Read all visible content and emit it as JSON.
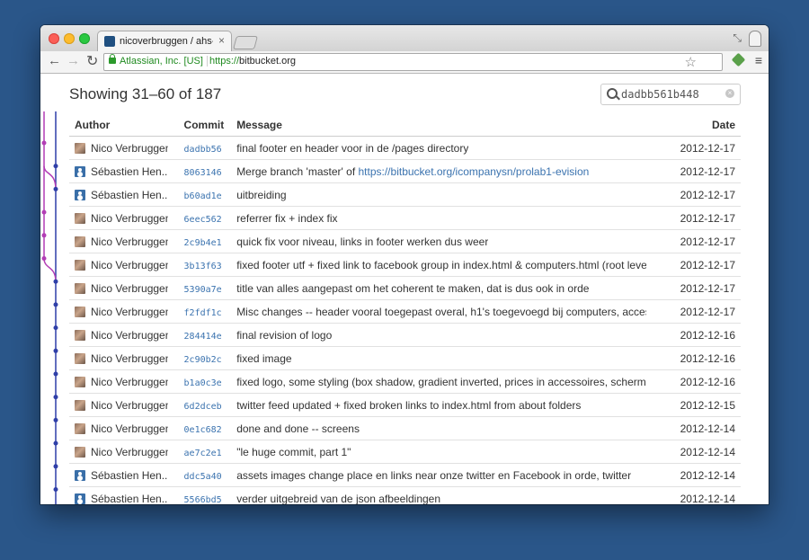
{
  "browser": {
    "tab_title": "nicoverbruggen / ahs-evi",
    "tab_close": "×",
    "ev_badge": "Atlassian, Inc. [US]",
    "url_scheme": "https://",
    "url_host": "bitbucket.org"
  },
  "page": {
    "heading": "Showing 31–60 of 187",
    "search": {
      "value": "dadbb561b448"
    },
    "columns": {
      "author": "Author",
      "commit": "Commit",
      "message": "Message",
      "date": "Date"
    }
  },
  "commits": [
    {
      "author": "Nico Verbruggen",
      "avatar": "photo",
      "hash": "dadbb56",
      "message": "final footer en header voor in de /pages directory",
      "date": "2012-12-17"
    },
    {
      "author": "Sébastien Hen...",
      "avatar": "default",
      "hash": "8063146",
      "message": "Merge branch 'master' of ",
      "link": "https://bitbucket.org/icompanysn/prolab1-evision",
      "date": "2012-12-17"
    },
    {
      "author": "Sébastien Hen...",
      "avatar": "default",
      "hash": "b60ad1e",
      "message": "uitbreiding",
      "date": "2012-12-17"
    },
    {
      "author": "Nico Verbruggen",
      "avatar": "photo",
      "hash": "6eec562",
      "message": "referrer fix + index fix",
      "date": "2012-12-17"
    },
    {
      "author": "Nico Verbruggen",
      "avatar": "photo",
      "hash": "2c9b4e1",
      "message": "quick fix voor niveau, links in footer werken dus weer",
      "date": "2012-12-17"
    },
    {
      "author": "Nico Verbruggen",
      "avatar": "photo",
      "hash": "3b13f63",
      "message": "fixed footer utf + fixed link to facebook group in index.html & computers.html (root level &",
      "date": "2012-12-17"
    },
    {
      "author": "Nico Verbruggen",
      "avatar": "photo",
      "hash": "5390a7e",
      "message": "title van alles aangepast om het coherent te maken, dat is dus ook in orde",
      "date": "2012-12-17"
    },
    {
      "author": "Nico Verbruggen",
      "avatar": "photo",
      "hash": "f2fdf1c",
      "message": "Misc changes -- header vooral toegepast overal, h1's toegevoegd bij computers, accessoires",
      "date": "2012-12-17"
    },
    {
      "author": "Nico Verbruggen",
      "avatar": "photo",
      "hash": "284414e",
      "message": "final revision of logo",
      "date": "2012-12-16"
    },
    {
      "author": "Nico Verbruggen",
      "avatar": "photo",
      "hash": "2c90b2c",
      "message": "fixed image",
      "date": "2012-12-16"
    },
    {
      "author": "Nico Verbruggen",
      "avatar": "photo",
      "hash": "b1a0c3e",
      "message": "fixed logo, some styling (box shadow, gradient inverted, prices in accessoires, schermen,",
      "date": "2012-12-16"
    },
    {
      "author": "Nico Verbruggen",
      "avatar": "photo",
      "hash": "6d2dceb",
      "message": "twitter feed updated + fixed broken links to index.html from about folders",
      "date": "2012-12-15"
    },
    {
      "author": "Nico Verbruggen",
      "avatar": "photo",
      "hash": "0e1c682",
      "message": "done and done -- screens",
      "date": "2012-12-14"
    },
    {
      "author": "Nico Verbruggen",
      "avatar": "photo",
      "hash": "ae7c2e1",
      "message": "\"le huge commit, part 1\"",
      "date": "2012-12-14"
    },
    {
      "author": "Sébastien Hen...",
      "avatar": "default",
      "hash": "ddc5a40",
      "message": "assets images change place en links near onze twitter en Facebook in orde, twitter",
      "date": "2012-12-14"
    },
    {
      "author": "Sébastien Hen...",
      "avatar": "default",
      "hash": "5566bd5",
      "message": "verder uitgebreid van de json afbeeldingen",
      "date": "2012-12-14"
    }
  ],
  "graph_colors": {
    "primary": "#2f3fa8",
    "secondary": "#b23db5"
  }
}
